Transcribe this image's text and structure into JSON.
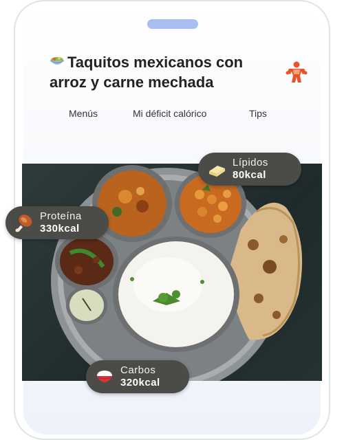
{
  "title": {
    "emoji_icon": "salad-bowl-icon",
    "line1": "Taquitos mexicanos con",
    "line2": "arroz y carne mechada"
  },
  "avatar_icon": "muscle-figure-icon",
  "tabs": [
    {
      "label": "Menús"
    },
    {
      "label": "Mi déficit calórico"
    },
    {
      "label": "Tips"
    }
  ],
  "photo_icon": "thali-meal-photo",
  "macros": {
    "lipids": {
      "label": "Lípidos",
      "value": "80kcal",
      "icon": "butter-icon"
    },
    "protein": {
      "label": "Proteína",
      "value": "330kcal",
      "icon": "drumstick-icon"
    },
    "carbs": {
      "label": "Carbos",
      "value": "320kcal",
      "icon": "rice-bowl-icon"
    }
  },
  "colors": {
    "accent": "#a9bdf0",
    "avatar": "#e8542a",
    "pill_bg": "#4b4b48"
  }
}
